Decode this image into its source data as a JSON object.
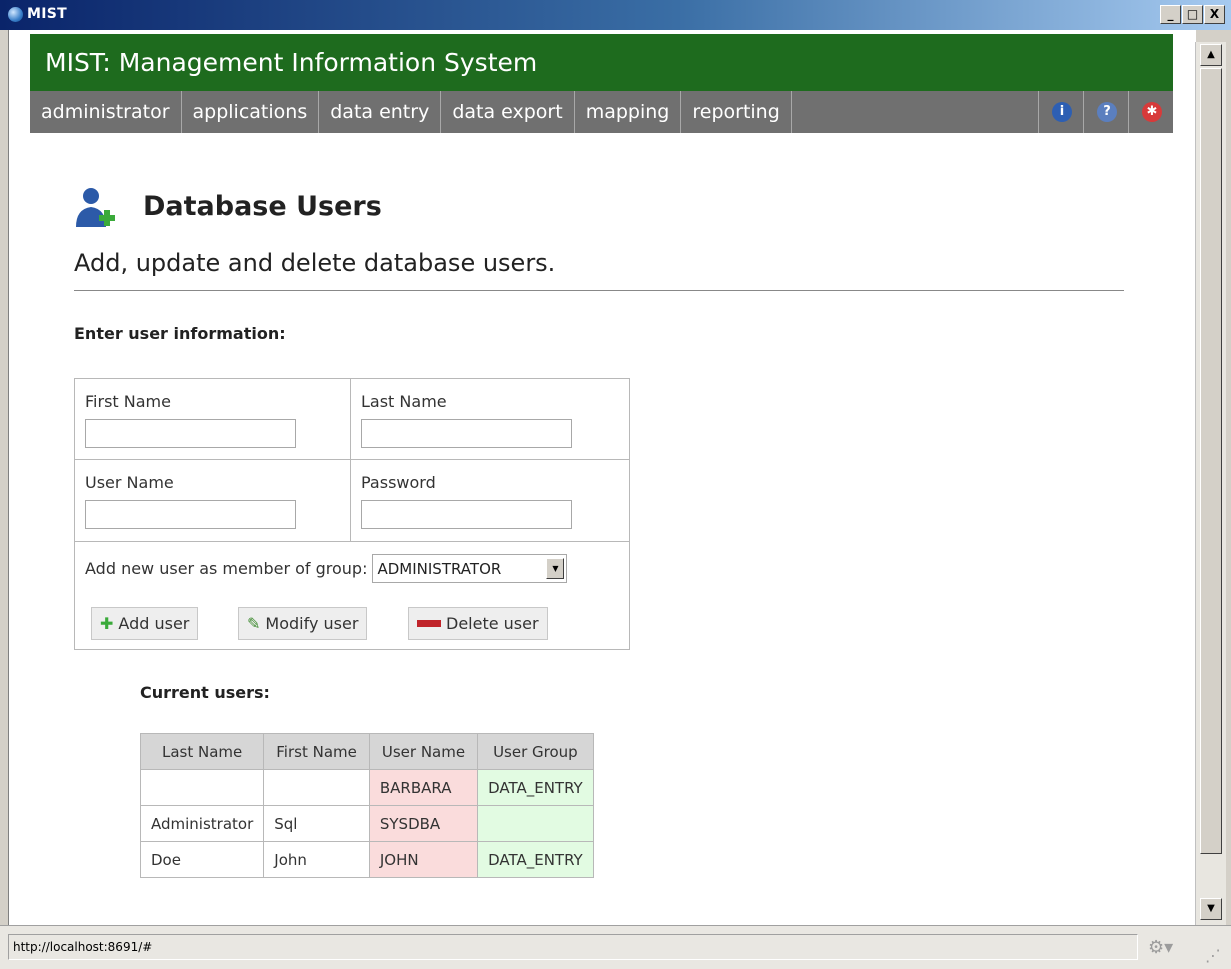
{
  "window": {
    "title": "MIST",
    "controls": {
      "minimize": "_",
      "maximize": "□",
      "close": "X"
    }
  },
  "app": {
    "header_title": "MIST: Management Information System",
    "nav": [
      "administrator",
      "applications",
      "data entry",
      "data export",
      "mapping",
      "reporting"
    ],
    "nav_icons": [
      {
        "name": "info-icon",
        "color": "#2d5fb3"
      },
      {
        "name": "help-icon",
        "color": "#5b7fbf"
      },
      {
        "name": "exit-icon",
        "color": "#d83a3a"
      }
    ]
  },
  "page": {
    "title": "Database Users",
    "subtitle": "Add, update and delete database users."
  },
  "form": {
    "section_label": "Enter user information:",
    "first_name_label": "First Name",
    "first_name_value": "",
    "last_name_label": "Last Name",
    "last_name_value": "",
    "user_name_label": "User Name",
    "user_name_value": "",
    "password_label": "Password",
    "password_value": "",
    "group_label": "Add new user as member of group:",
    "group_selected": "ADMINISTRATOR",
    "buttons": {
      "add": "Add user",
      "modify": "Modify user",
      "delete": "Delete user"
    }
  },
  "users": {
    "section_label": "Current users:",
    "headers": [
      "Last Name",
      "First Name",
      "User Name",
      "User Group"
    ],
    "rows": [
      [
        "",
        "",
        "BARBARA",
        "DATA_ENTRY"
      ],
      [
        "Administrator",
        "Sql",
        "SYSDBA",
        ""
      ],
      [
        "Doe",
        "John",
        "JOHN",
        "DATA_ENTRY"
      ]
    ]
  },
  "status": {
    "url": "http://localhost:8691/#"
  }
}
